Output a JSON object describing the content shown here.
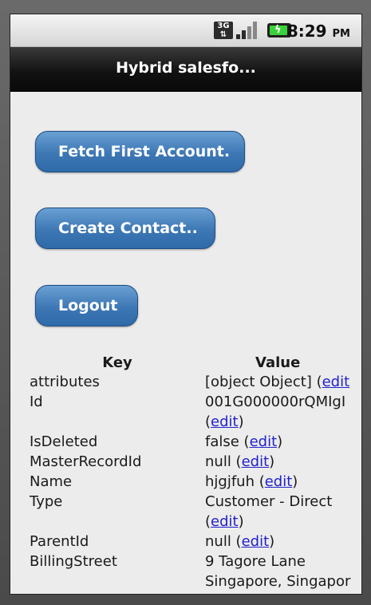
{
  "status_bar": {
    "network": "3G",
    "time": "8:29",
    "ampm": "PM"
  },
  "app": {
    "title": "Hybrid salesfo..."
  },
  "buttons": {
    "fetch_label": "Fetch First Account.",
    "create_label": "Create Contact..",
    "logout_label": "Logout"
  },
  "table": {
    "header_key": "Key",
    "header_value": "Value",
    "rows": [
      {
        "key": "attributes",
        "value": "[object Object] (",
        "value2": "",
        "edit": "edit"
      },
      {
        "key": "Id",
        "value": "001G000000rQMIgI",
        "value2": "(",
        "edit": "edit"
      },
      {
        "key": "IsDeleted",
        "value": "false (",
        "value2": "",
        "edit": "edit"
      },
      {
        "key": "MasterRecordId",
        "value": "null (",
        "value2": "",
        "edit": "edit"
      },
      {
        "key": "Name",
        "value": "hjgjfuh (",
        "value2": "",
        "edit": "edit"
      },
      {
        "key": "Type",
        "value": "Customer - Direct",
        "value2": "(",
        "edit": "edit"
      },
      {
        "key": "ParentId",
        "value": "null (",
        "value2": "",
        "edit": "edit"
      },
      {
        "key": "BillingStreet",
        "value": "9 Tagore Lane",
        "value2": "Singapore, Singapor",
        "edit": ""
      }
    ]
  },
  "colors": {
    "button_blue": "#3d77b4",
    "link": "#2222cc",
    "titlebar": "#111111",
    "battery": "#3ad23a"
  }
}
